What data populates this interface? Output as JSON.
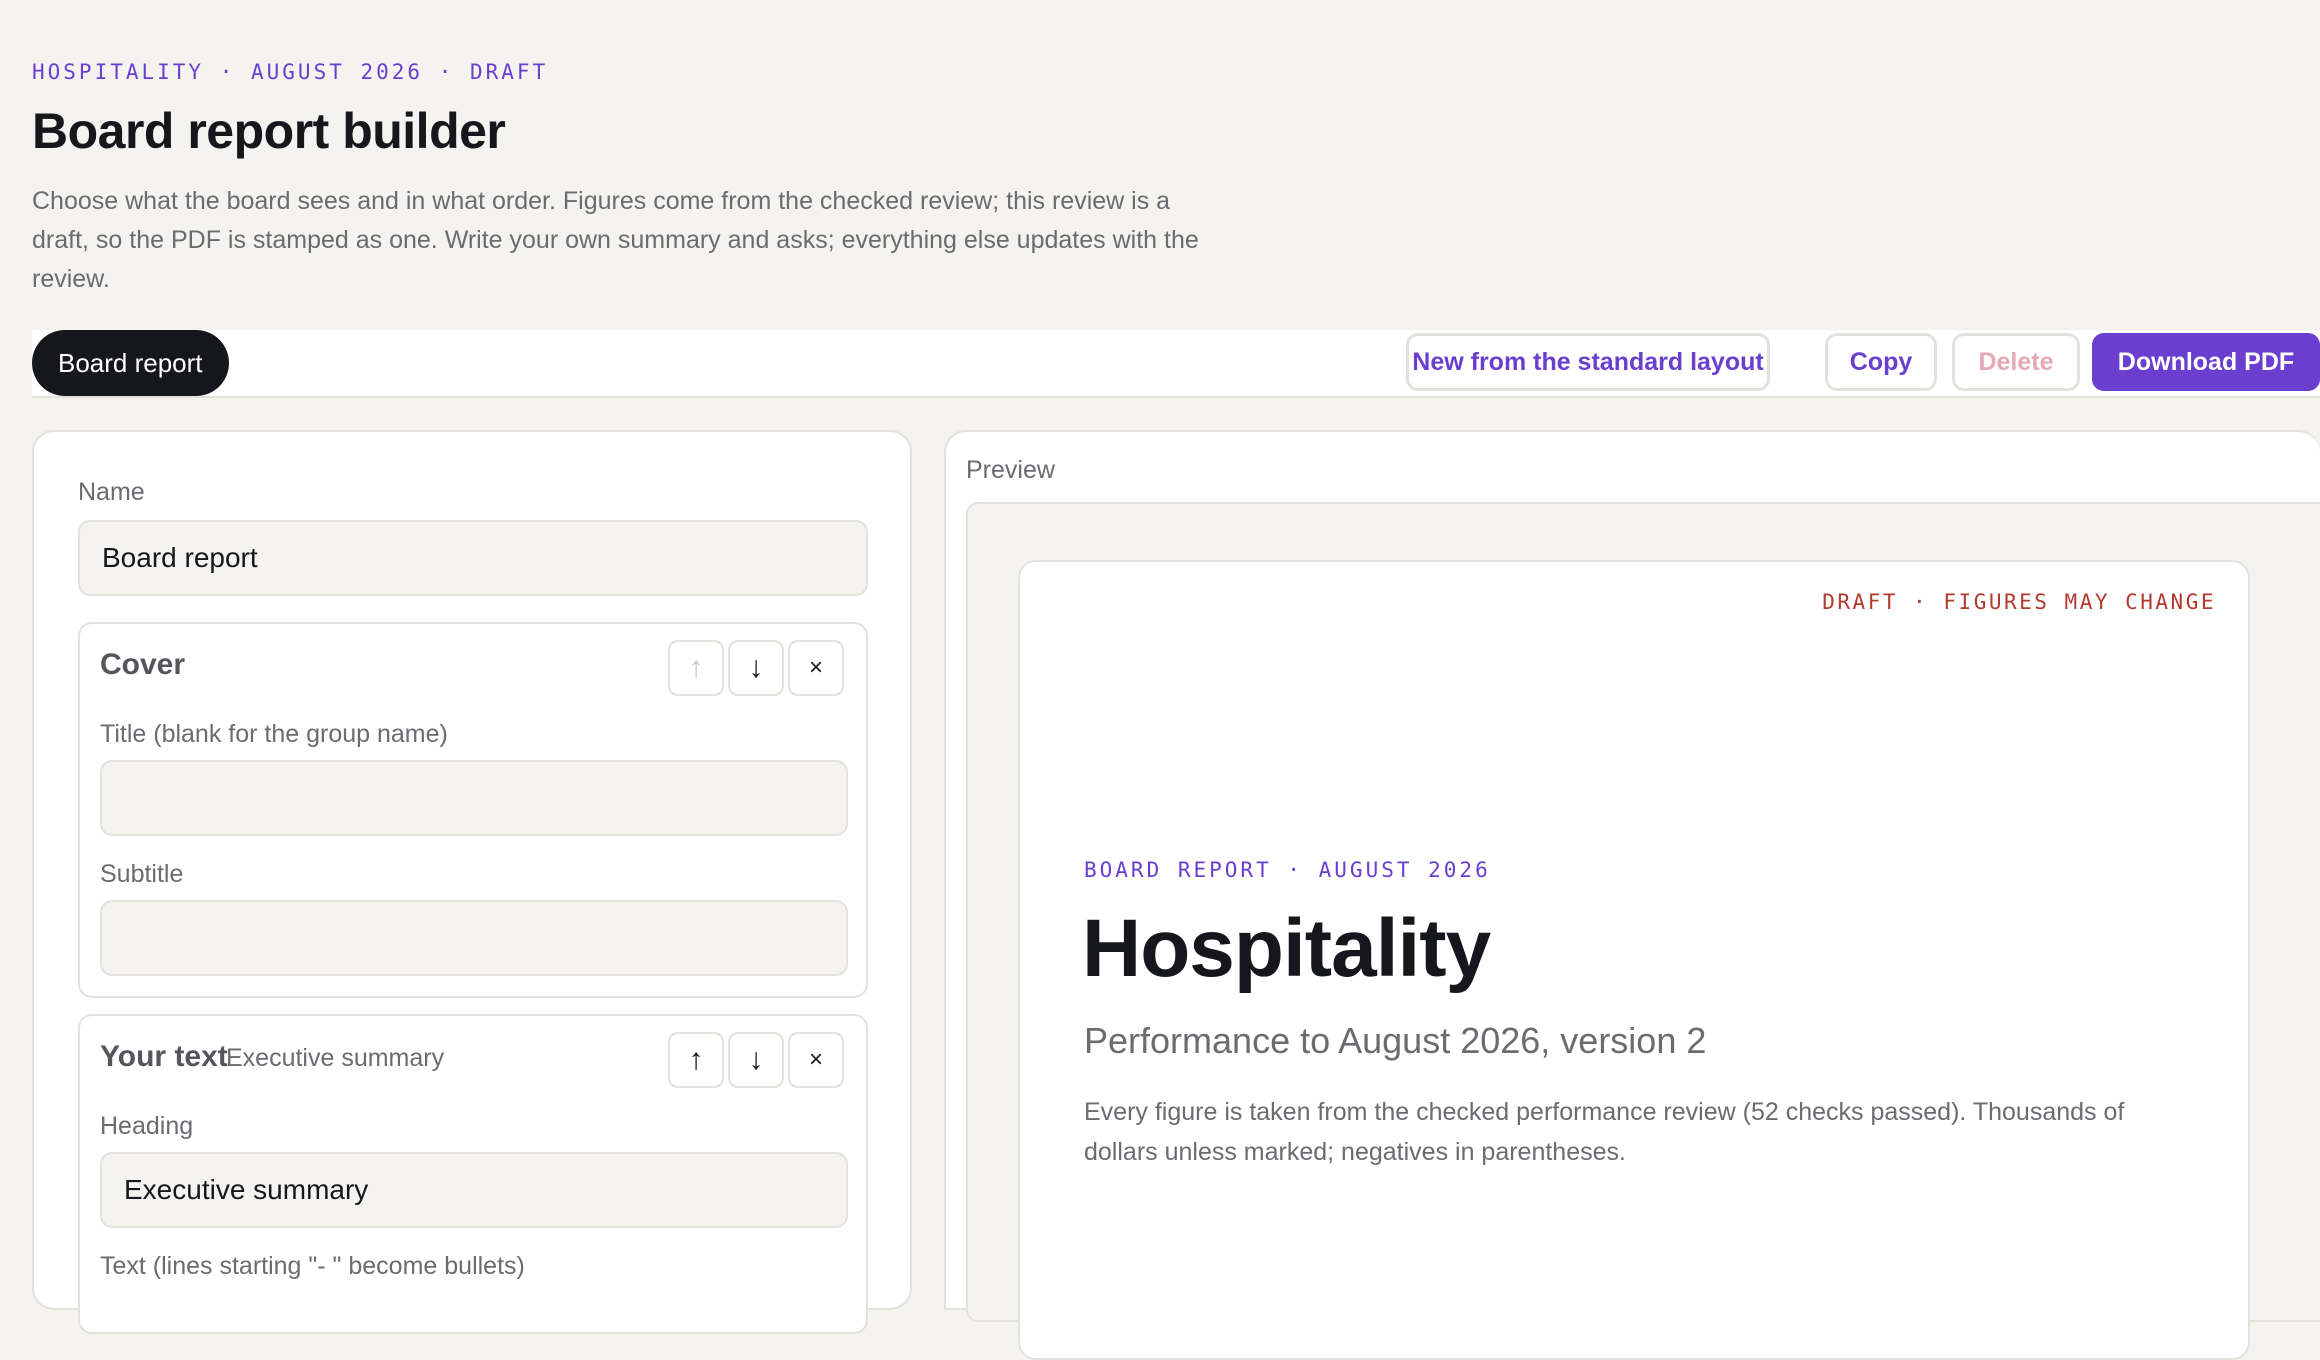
{
  "header": {
    "eyebrow": "HOSPITALITY · AUGUST 2026 · DRAFT",
    "title": "Board report builder",
    "intro": "Choose what the board sees and in what order. Figures come from the checked review; this review is a draft, so the PDF is stamped as one. Write your own summary and asks; everything else updates with the review."
  },
  "toolbar": {
    "active_tab": "Board report",
    "new_label": "New from the standard layout",
    "copy_label": "Copy",
    "delete_label": "Delete",
    "download_label": "Download PDF"
  },
  "editor": {
    "name_label": "Name",
    "name_value": "Board report",
    "cover": {
      "title": "Cover",
      "title_field_label": "Title (blank for the group name)",
      "title_field_value": "",
      "subtitle_field_label": "Subtitle",
      "subtitle_field_value": ""
    },
    "your_text": {
      "title": "Your text",
      "subtitle": "Executive summary",
      "heading_label": "Heading",
      "heading_value": "Executive summary",
      "text_label": "Text (lines starting \"- \" become bullets)"
    },
    "icons": {
      "up": "↑",
      "down": "↓",
      "close": "×"
    }
  },
  "preview": {
    "label": "Preview",
    "stamp": "DRAFT · FIGURES MAY CHANGE",
    "eyebrow": "BOARD REPORT · AUGUST 2026",
    "title": "Hospitality",
    "subtitle": "Performance to August 2026, version 2",
    "body": "Every figure is taken from the checked performance review (52 checks passed). Thousands of dollars unless marked; negatives in parentheses."
  },
  "colors": {
    "accent": "#6a3fd0",
    "background": "#f4f3ef",
    "draft_red": "#b23a2e",
    "dark": "#16171c"
  }
}
